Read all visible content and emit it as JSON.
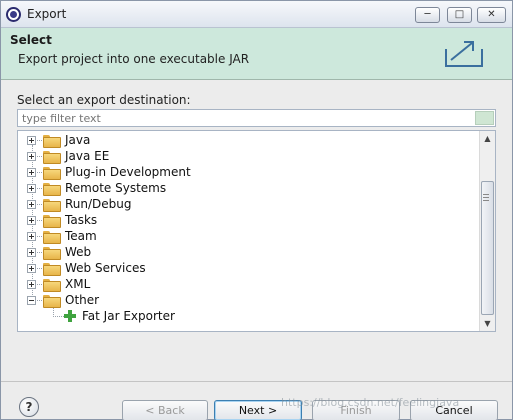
{
  "window": {
    "title": "Export"
  },
  "titlebar_buttons": {
    "minimize": "─",
    "maximize": "□",
    "close": "✕"
  },
  "banner": {
    "title": "Select",
    "description": "Export project into one executable JAR",
    "accent": "#cde8dc"
  },
  "dest": {
    "label": "Select an export destination:",
    "filter_placeholder": "type filter text",
    "filter_value": ""
  },
  "tree": {
    "items": [
      {
        "label": "Java",
        "expanded": false
      },
      {
        "label": "Java EE",
        "expanded": false
      },
      {
        "label": "Plug-in Development",
        "expanded": false
      },
      {
        "label": "Remote Systems",
        "expanded": false
      },
      {
        "label": "Run/Debug",
        "expanded": false
      },
      {
        "label": "Tasks",
        "expanded": false
      },
      {
        "label": "Team",
        "expanded": false
      },
      {
        "label": "Web",
        "expanded": false
      },
      {
        "label": "Web Services",
        "expanded": false
      },
      {
        "label": "XML",
        "expanded": false
      },
      {
        "label": "Other",
        "expanded": true
      }
    ],
    "child": {
      "label": "Fat Jar Exporter",
      "icon": "green-plus-icon"
    }
  },
  "scrollbar": {
    "up": "▲",
    "down": "▼",
    "thumb_position": 0.75
  },
  "buttons": {
    "help": "?",
    "back": "< Back",
    "next": "Next >",
    "finish": "Finish",
    "cancel": "Cancel"
  },
  "watermark": "https://blog.csdn.net/feelingjava"
}
